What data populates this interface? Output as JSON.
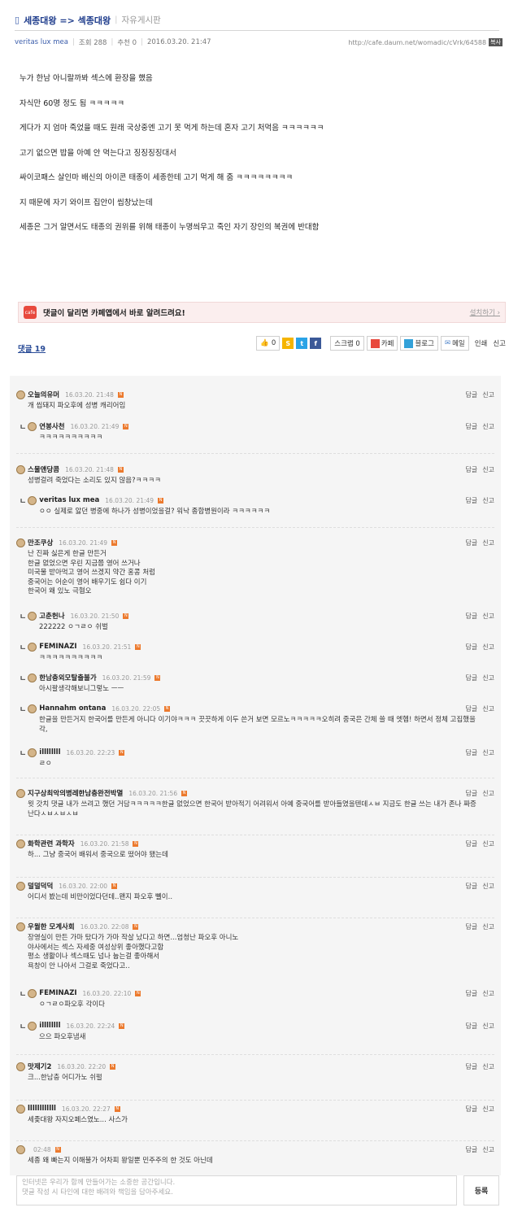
{
  "header": {
    "board_prefix": "▯",
    "title": "세종대왕 => 섹종대왕",
    "board": "자유게시판"
  },
  "meta": {
    "author": "veritas lux mea",
    "views": "조회 288",
    "likes": "추천 0",
    "date": "2016.03.20. 21:47",
    "url": "http://cafe.daum.net/womadic/cVrk/64588",
    "url_button": "복사"
  },
  "post_lines": [
    "누가 한남 아니랄까봐 섹스에 환장을 했음",
    "자식만 60명 정도 됨 ㅋㅋㅋㅋㅋ",
    "게다가 지 엄마 죽었을 때도 원래 국상중엔 고기 못 먹게 하는데 혼자 고기 처먹음 ㅋㅋㅋㅋㅋㅋ",
    "고기 없으면 밥을 아예 안 먹는다고 징징징징대서",
    "싸이코패스 살인마 배신의 아이콘 태종이 세종한테 고기 먹게 해 줌 ㅋㅋㅋㅋㅋㅋㅋㅋ",
    "지 때문에 자기 와이프 집안이 씹창났는데",
    "세종은 그거 알면서도 태종의 권위를 위해 태종이 누명씌우고 죽인 자기 장인의 복권에 반대함"
  ],
  "banner": {
    "icon": "cafe",
    "message": "댓글이 달리면 카페앱에서 바로 알려드려요!",
    "install": "설치하기 ›"
  },
  "actions": {
    "comment_count": "댓글 19",
    "like": "0",
    "scrap": "스크랩 0",
    "cafe": "카페",
    "blog": "블로그",
    "mail": "메일",
    "print": "인쇄",
    "report": "신고"
  },
  "comments": [
    {
      "nick": "오늘의유머",
      "time": "16.03.20. 21:48",
      "text": "개 씹돼지 파오후에 성병 캐리어임",
      "reply": false
    },
    {
      "nick": "연봉사천",
      "time": "16.03.20. 21:49",
      "text": "ㅋㅋㅋㅋㅋㅋㅋㅋㅋㅋ",
      "reply": true
    },
    {
      "nick": "스물앤당콤",
      "time": "16.03.20. 21:48",
      "text": "성병걸려 죽었다는 소리도 있지 않음?ㅋㅋㅋㅋ",
      "reply": false
    },
    {
      "nick": "veritas lux mea",
      "time": "16.03.20. 21:49",
      "text": "ㅇㅇ 실제로 앓던 병중에 하나가 성병이었을걸? 워낙 종합병원이라 ㅋㅋㅋㅋㅋㅋ",
      "reply": true
    },
    {
      "nick": "만조쿠상",
      "time": "16.03.20. 21:49",
      "text": "난 진짜 싫은게 한글 만든거\n한글 없었으면 우린 지금쯤 영어 쓰거나\n미국물 받아먹고 영어 쓰겠지 약간 홍콩 처럼\n중국어는 어순이 영어 배우기도 쉽다 이기\n한국어 왜 있노 극혐오",
      "reply": false
    },
    {
      "nick": "고춘헌나",
      "time": "16.03.20. 21:50",
      "text": "222222 ㅇㄱㄹㅇ 쉬벌",
      "reply": true
    },
    {
      "nick": "FEMINAZI",
      "time": "16.03.20. 21:51",
      "text": "ㅋㅋㅋㅋㅋㅋㅋㅋㅋㅋ",
      "reply": true
    },
    {
      "nick": "한남충외모탈출불가",
      "time": "16.03.20. 21:59",
      "text": "아시팔생각해보니그렇노 ㅡㅡ",
      "reply": true
    },
    {
      "nick": "Hannahm ontana",
      "time": "16.03.20. 22:05",
      "text": "한글을 만든거지 한국어를 만든게 아니다 이기야ㅋㅋㅋ 끗끗하게 이두 쓴거 보면 모르노ㅋㅋㅋㅋㅋ오히려 중국은 간체 쓸 때 엣헴! 하면서 정체 고집했을 각,",
      "reply": true
    },
    {
      "nick": "illllllll",
      "time": "16.03.20. 22:23",
      "text": "ㄹㅇ",
      "reply": true
    },
    {
      "nick": "지구상최악의병레한남충완전박멸",
      "time": "16.03.20. 21:56",
      "text": "윗 갓치 댓글 내가 쓰려고 했던 거담ㅋㅋㅋㅋㅋ한글 없었으면 한국어 받아적기 어려워서 아예 중국어를 받아들였을텐데ㅅㅂ 지금도 한글 쓰는 내가 존나 짜증난다ㅅㅂㅅㅂㅅㅂ",
      "reply": false
    },
    {
      "nick": "화학관련 과학자",
      "time": "16.03.20. 21:58",
      "text": "하... 그냥 중국어 배워서 중국으로 떴어야 됐는데",
      "reply": false
    },
    {
      "nick": "덜덜덕덕",
      "time": "16.03.20. 22:00",
      "text": "어디서 봤는데 비만이었다던데..왠지 파오후 뻴이..",
      "reply": false
    },
    {
      "nick": "우월한 모계사회",
      "time": "16.03.20. 22:08",
      "text": "장영실이 만든 가마 탔다가 가마 작살 났다고 하면...엄청난 파오후 아니노\n야사에서는 섹스 자세중 여성상위 좋아했다고함\n평소 생활이나 섹스때도 넘나 눕는걸 좋아해서\n욕창이 안 나아서 그걸로 죽었다고..",
      "reply": false
    },
    {
      "nick": "FEMINAZI",
      "time": "16.03.20. 22:10",
      "text": "ㅇㄱㄹㅇ파오후 각이다",
      "reply": true
    },
    {
      "nick": "illllllll",
      "time": "16.03.20. 22:24",
      "text": "으으 파오후냄새",
      "reply": true
    },
    {
      "nick": "맛제기2",
      "time": "16.03.20. 22:20",
      "text": "크...한남충 어디가노 쉬펄",
      "reply": false
    },
    {
      "nick": "llllllllllll",
      "time": "16.03.20. 22:27",
      "text": "세좆대왕 자지오페스였노... 사스가",
      "reply": false
    },
    {
      "nick": "",
      "time": "02:48",
      "text": "세종 왜 빠는지 이해불가 어차피 왕일뿐 민주주의 한 것도 아닌데",
      "reply": false
    }
  ],
  "comment_links": {
    "reply": "답글",
    "report": "신고"
  },
  "write": {
    "placeholder": "인터넷은 우리가 함께 만들어가는 소중한 공간입니다.\n댓글 작성 시 타인에 대한 배려와 책임을 담아주세요.",
    "submit": "등록"
  }
}
